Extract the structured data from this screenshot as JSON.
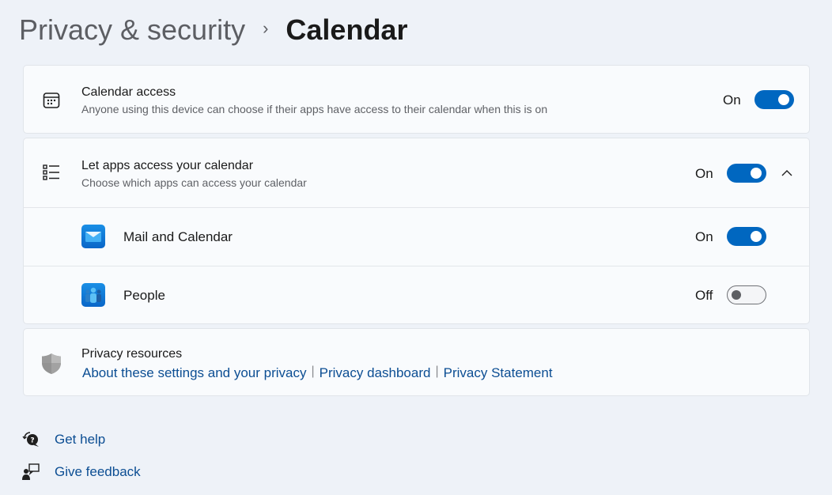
{
  "breadcrumb": {
    "parent": "Privacy & security",
    "separator": "›",
    "current": "Calendar"
  },
  "calendar_access": {
    "icon": "calendar-icon",
    "title": "Calendar access",
    "subtitle": "Anyone using this device can choose if their apps have access to their calendar when this is on",
    "state_label": "On",
    "enabled": true
  },
  "let_apps_access": {
    "icon": "list-icon",
    "title": "Let apps access your calendar",
    "subtitle": "Choose which apps can access your calendar",
    "state_label": "On",
    "enabled": true,
    "expanded": true,
    "expander_icon": "chevron-up-icon",
    "apps": [
      {
        "name": "Mail and Calendar",
        "icon": "mail-app-icon",
        "state_label": "On",
        "enabled": true
      },
      {
        "name": "People",
        "icon": "people-app-icon",
        "state_label": "Off",
        "enabled": false
      }
    ]
  },
  "privacy_resources": {
    "icon": "shield-icon",
    "title": "Privacy resources",
    "links": [
      "About these settings and your privacy",
      "Privacy dashboard",
      "Privacy Statement"
    ],
    "link_separator": "|"
  },
  "footer": {
    "get_help": {
      "label": "Get help",
      "icon": "help-icon"
    },
    "give_feedback": {
      "label": "Give feedback",
      "icon": "feedback-icon"
    }
  },
  "colors": {
    "accent": "#0067c0",
    "link": "#0c4e93",
    "background": "#eef2f8",
    "card": "#f9fbfd"
  }
}
